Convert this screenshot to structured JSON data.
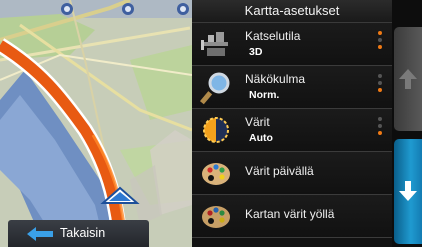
{
  "panel": {
    "title": "Kartta-asetukset",
    "items": [
      {
        "label": "Katselutila",
        "value": "3D",
        "icon": "view-mode-icon",
        "selected_index": 0
      },
      {
        "label": "Näkökulma",
        "value": "Norm.",
        "icon": "magnifier-icon",
        "selected_index": 2
      },
      {
        "label": "Värit",
        "value": "Auto",
        "icon": "day-night-icon",
        "selected_index": 2
      },
      {
        "label": "Värit päivällä",
        "icon": "palette-icon"
      },
      {
        "label": "Kartan värit yöllä",
        "icon": "palette-night-icon"
      }
    ]
  },
  "back_button": {
    "label": "Takaisin",
    "icon": "back-arrow-icon"
  },
  "colors": {
    "accent": "#f07a14",
    "scroll_active": "#1f9ad0",
    "route": "#e85a12"
  }
}
